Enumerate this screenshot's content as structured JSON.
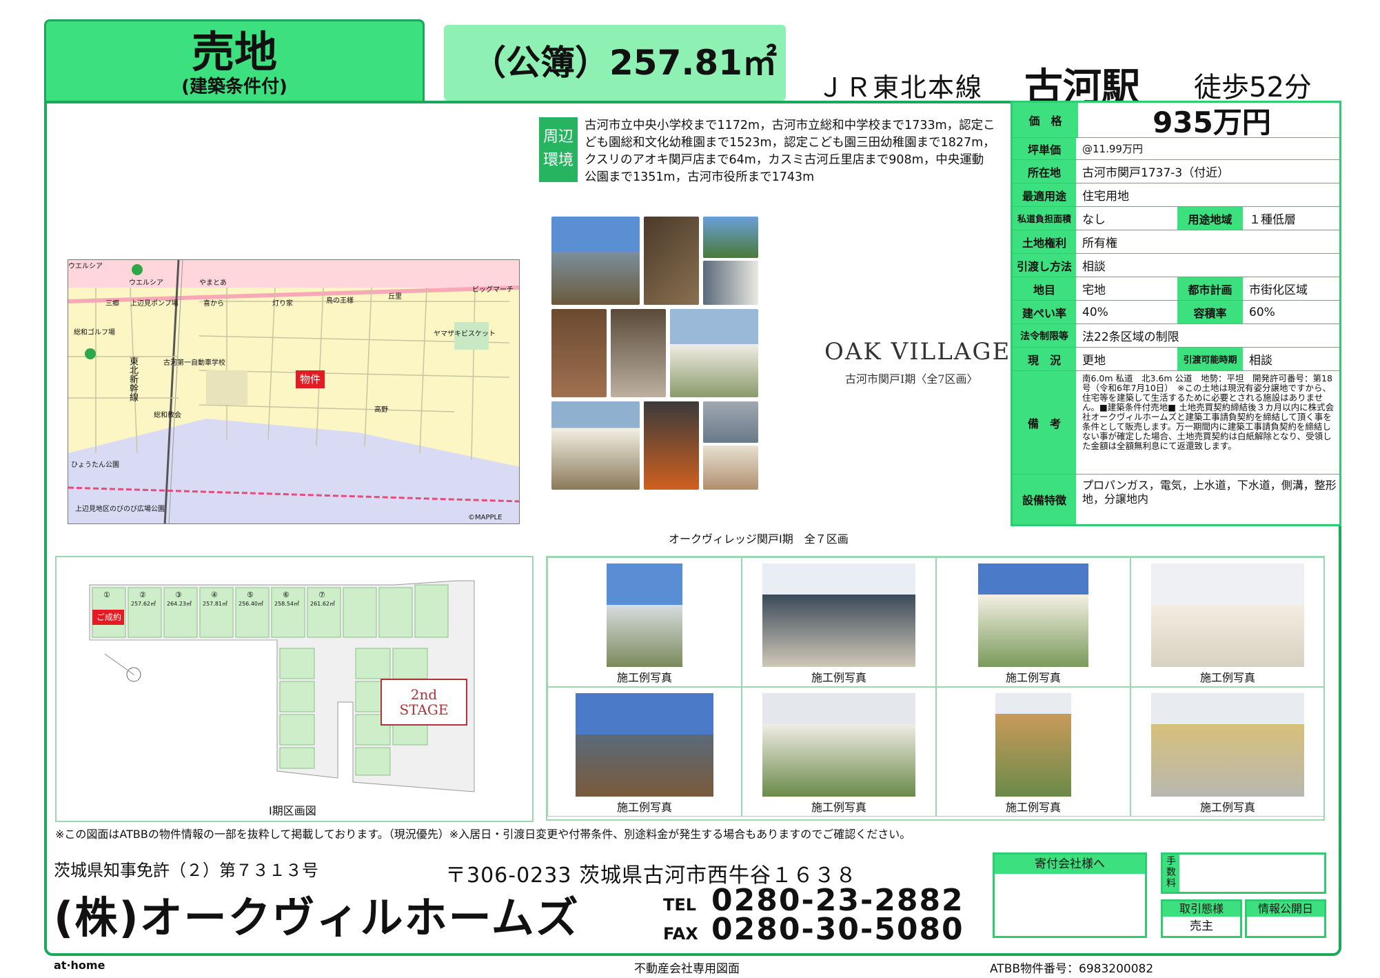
{
  "header": {
    "type_main": "売地",
    "type_sub": "(建築条件付)",
    "area": "（公簿）257.81㎡",
    "line": "ＪＲ東北本線",
    "station": "古河駅",
    "walk": "徒歩52分"
  },
  "env": {
    "label": "周辺環境",
    "text": "古河市立中央小学校まで1172m，古河市立総和中学校まで1733m，認定こども園総和文化幼稚園まで1523m，認定こども園三田幼稚園まで1827m，クスリのアオキ関戸店まで64m，カスミ古河丘里店まで908m，中央運動公園まで1351m，古河市役所まで1743m"
  },
  "map": {
    "labels": [
      "ウエルシア",
      "やまとあ",
      "三郷",
      "上辺見ポンプ場",
      "喜から",
      "灯り家",
      "鳥の王様",
      "丘里",
      "ビッグマーチ",
      "総和ゴルフ場",
      "ヤマザキビスケット",
      "古河第一自動車学校",
      "物件",
      "東北新幹線",
      "総和教会",
      "高野",
      "ひょうたん公園",
      "上辺見地区のびのび広場公園",
      "©MAPPLE"
    ]
  },
  "oak": {
    "logo": "OAK VILLAGE",
    "sub": "古河市関戸Ⅰ期〈全7区画〉",
    "caption": "オークヴィレッジ関戸Ⅰ期　全７区画"
  },
  "info": {
    "price_label": "価　格",
    "price": "935万円",
    "unit_label": "坪単価",
    "unit": "@11.99万円",
    "loc_label": "所在地",
    "loc": "古河市関戸1737-3（付近）",
    "use_label": "最適用途",
    "use": "住宅用地",
    "road_label": "私道負担面積",
    "road": "なし",
    "zone_label": "用途地域",
    "zone": "１種低層",
    "right_label": "土地権利",
    "right": "所有権",
    "deliver_label": "引渡し方法",
    "deliver": "相談",
    "cat_label": "地目",
    "cat": "宅地",
    "city_label": "都市計画",
    "city": "市街化区域",
    "bcr_label": "建ぺい率",
    "bcr": "40%",
    "far_label": "容積率",
    "far": "60%",
    "law_label": "法令制限等",
    "law": "法22条区域の制限",
    "status_label": "現　況",
    "status": "更地",
    "deliv_time_label": "引渡可能時期",
    "deliv_time": "相談",
    "note_label": "備　考",
    "note": "南6.0m 私道　北3.6m 公道　地勢：平坦　開発許可番号：第18号（令和6年7月10日）　※この土地は現況有姿分譲地ですから、住宅等を建築して生活するために必要とされる施設はありません。■建築条件付売地■ 土地売買契約締結後３カ月以内に株式会社オークヴィルホームズと建築工事請負契約を締結して頂く事を条件として販売します。万一期間内に建築工事請負契約を締結しない事が確定した場合、土地売買契約は白紙解除となり、受領した金額は全額無利息にて返還致します。",
    "equip_label": "設備特徴",
    "equip": "プロパンガス，電気，上水道，下水道，側溝，整形地，分譲地内"
  },
  "plan": {
    "caption": "Ⅰ期区画図",
    "sold": "ご成約",
    "stage": "2nd\nSTAGE",
    "lots": [
      "①",
      "②",
      "③",
      "④",
      "⑤",
      "⑥",
      "⑦"
    ],
    "areas": [
      "",
      "257.62㎡",
      "264.23㎡",
      "257.81㎡",
      "256.40㎡",
      "258.54㎡",
      "261.62㎡"
    ]
  },
  "examples": {
    "caption": "施工例写真"
  },
  "notice": "※この図面はATBBの物件情報の一部を抜粋して掲載しております。（現況優先）※入居日・引渡日変更や付帯条件、別途料金が発生する場合もありますのでご確認ください。",
  "footer": {
    "license": "茨城県知事免許（２）第７３１３号",
    "company": "(株)オークヴィルホームズ",
    "address": "〒306-0233  茨城県古河市西牛谷１６３８",
    "tel_label": "TEL",
    "tel": "0280-23-2882",
    "fax_label": "FAX",
    "fax": "0280-30-5080",
    "sender_label": "寄付会社様へ",
    "fee_label": "手数料",
    "deal_label": "取引態様",
    "deal": "売主",
    "publish_label": "情報公開日",
    "athome": "at·home",
    "pro_only": "不動産会社専用図面",
    "atbb": "ATBB物件番号：6983200082"
  },
  "colors": {
    "accent": "#3de07f",
    "border": "#1aa85a",
    "area_bg": "#8ff0b4"
  }
}
